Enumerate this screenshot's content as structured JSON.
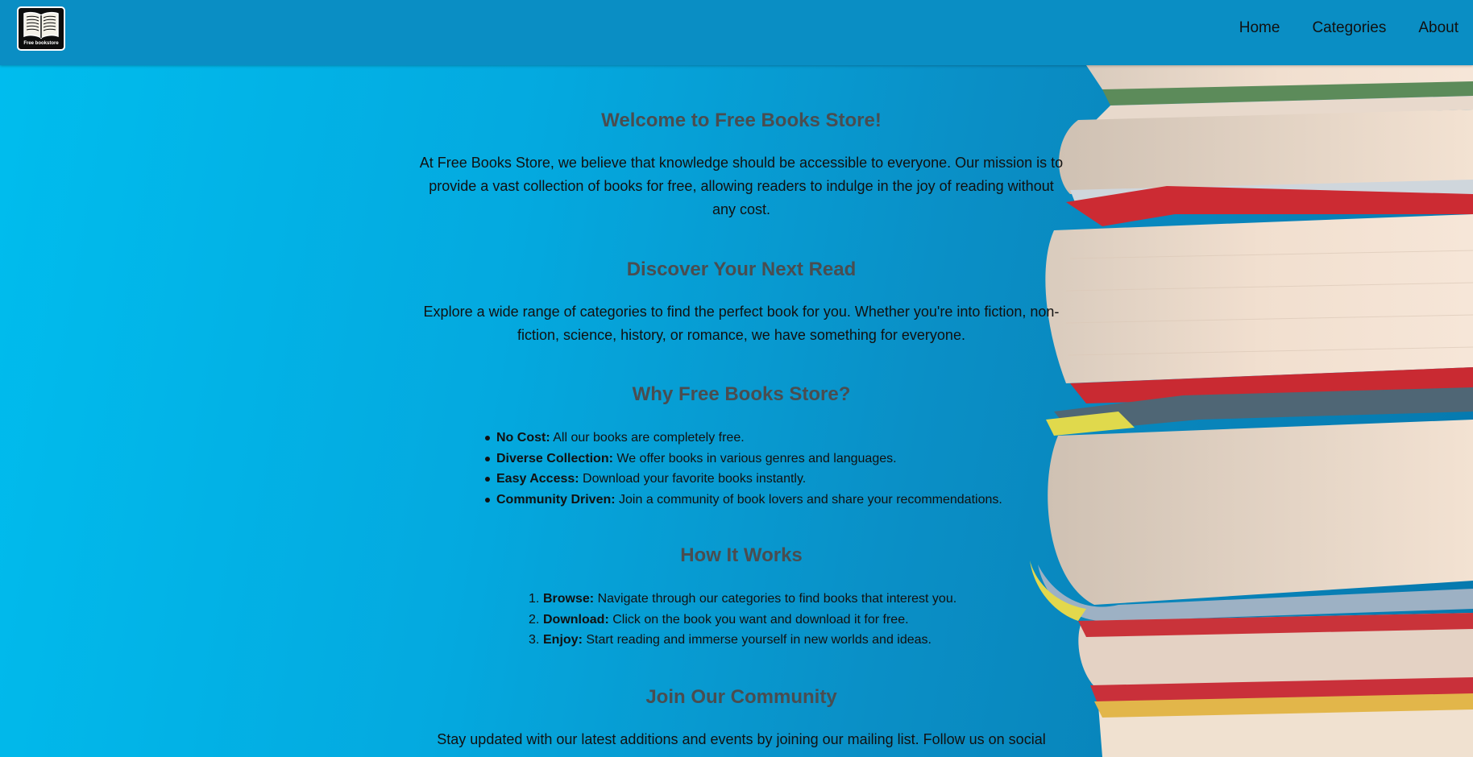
{
  "header": {
    "logo_text": "Free bookstore",
    "nav": [
      {
        "label": "Home"
      },
      {
        "label": "Categories"
      },
      {
        "label": "About"
      }
    ]
  },
  "sections": {
    "welcome": {
      "heading": "Welcome to Free Books Store!",
      "text": "At Free Books Store, we believe that knowledge should be accessible to everyone. Our mission is to provide a vast collection of books for free, allowing readers to indulge in the joy of reading without any cost."
    },
    "discover": {
      "heading": "Discover Your Next Read",
      "text": "Explore a wide range of categories to find the perfect book for you. Whether you're into fiction, non-fiction, science, history, or romance, we have something for everyone."
    },
    "why": {
      "heading": "Why Free Books Store?",
      "items": [
        {
          "title": "No Cost:",
          "text": " All our books are completely free."
        },
        {
          "title": "Diverse Collection:",
          "text": " We offer books in various genres and languages."
        },
        {
          "title": "Easy Access:",
          "text": " Download your favorite books instantly."
        },
        {
          "title": "Community Driven:",
          "text": " Join a community of book lovers and share your recommendations."
        }
      ]
    },
    "how": {
      "heading": "How It Works",
      "items": [
        {
          "num": "1.",
          "title": "Browse:",
          "text": " Navigate through our categories to find books that interest you."
        },
        {
          "num": "2.",
          "title": "Download:",
          "text": " Click on the book you want and download it for free."
        },
        {
          "num": "3.",
          "title": "Enjoy:",
          "text": " Start reading and immerse yourself in new worlds and ideas."
        }
      ]
    },
    "join": {
      "heading": "Join Our Community",
      "text": "Stay updated with our latest additions and events by joining our mailing list. Follow us on social"
    }
  },
  "colors": {
    "navbar": "#0a8ec4",
    "heading": "#4a4d50",
    "background_light": "#00bdee",
    "background_dark": "#0678ad"
  }
}
